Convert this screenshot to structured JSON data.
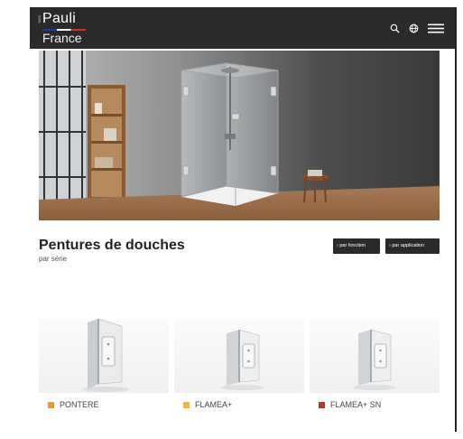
{
  "header": {
    "logo": {
      "sas": "SAS",
      "brand": "Pauli",
      "country": "France"
    },
    "icons": [
      "search-icon",
      "globe-icon",
      "menu-icon"
    ]
  },
  "hero": {
    "image": "glass-shower-cabin-room"
  },
  "section": {
    "title": "Pentures de douches",
    "subtitle": "par série",
    "buttons": {
      "fonction": "› par fonction",
      "application": "› par application"
    }
  },
  "products": [
    {
      "label": "PONTERE",
      "color": "#f29a1f"
    },
    {
      "label": "FLAMEA+",
      "color": "#f7b81a"
    },
    {
      "label": "FLAMEA+ SN",
      "color": "#d42a1e"
    }
  ]
}
